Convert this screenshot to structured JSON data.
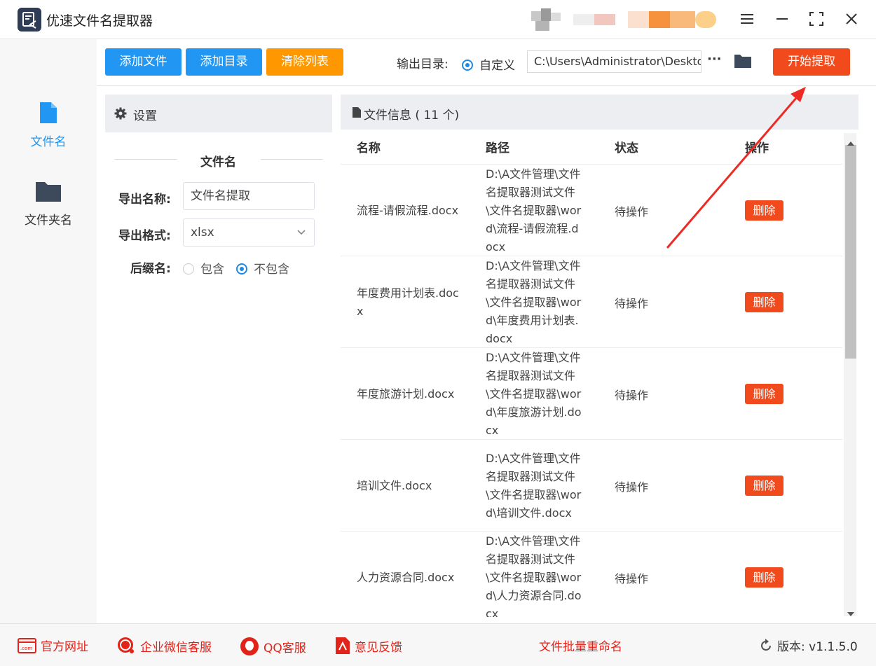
{
  "app": {
    "title": "优速文件名提取器"
  },
  "sidebar": {
    "items": [
      {
        "label": "文件名",
        "icon": "file-icon",
        "active": true
      },
      {
        "label": "文件夹名",
        "icon": "folder-icon",
        "active": false
      }
    ]
  },
  "toolbar": {
    "add_file": "添加文件",
    "add_dir": "添加目录",
    "clear_list": "清除列表",
    "output_label": "输出目录:",
    "custom_label": "自定义",
    "output_path": "C:\\Users\\Administrator\\Desktop",
    "more": "···",
    "start": "开始提取"
  },
  "settings": {
    "header": "设置",
    "section_title": "文件名",
    "export_name_label": "导出名称:",
    "export_name_value": "文件名提取",
    "export_format_label": "导出格式:",
    "export_format_value": "xlsx",
    "suffix_label": "后缀名:",
    "suffix_include": "包含",
    "suffix_exclude": "不包含",
    "suffix_selected": "不包含"
  },
  "fileinfo": {
    "header": "文件信息 ( 11 个)",
    "columns": [
      "名称",
      "路径",
      "状态",
      "操作"
    ],
    "rows": [
      {
        "name": "流程-请假流程.docx",
        "path": "D:\\A文件管理\\文件名提取器测试文件\\文件名提取器\\word\\流程-请假流程.docx",
        "status": "待操作",
        "action": "删除"
      },
      {
        "name": "年度费用计划表.docx",
        "path": "D:\\A文件管理\\文件名提取器测试文件\\文件名提取器\\word\\年度费用计划表.docx",
        "status": "待操作",
        "action": "删除"
      },
      {
        "name": "年度旅游计划.docx",
        "path": "D:\\A文件管理\\文件名提取器测试文件\\文件名提取器\\word\\年度旅游计划.docx",
        "status": "待操作",
        "action": "删除"
      },
      {
        "name": "培训文件.docx",
        "path": "D:\\A文件管理\\文件名提取器测试文件\\文件名提取器\\word\\培训文件.docx",
        "status": "待操作",
        "action": "删除"
      },
      {
        "name": "人力资源合同.docx",
        "path": "D:\\A文件管理\\文件名提取器测试文件\\文件名提取器\\word\\人力资源合同.docx",
        "status": "待操作",
        "action": "删除"
      }
    ]
  },
  "footer": {
    "website": "官方网址",
    "wechat": "企业微信客服",
    "qq": "QQ客服",
    "feedback": "意见反馈",
    "batch_rename": "文件批量重命名",
    "version": "版本: v1.1.5.0"
  },
  "colors": {
    "primary_blue": "#2196f3",
    "orange": "#ff9800",
    "start_red": "#f14a1c",
    "footer_red": "#e2231a",
    "arrow_red": "#ee2a24"
  }
}
